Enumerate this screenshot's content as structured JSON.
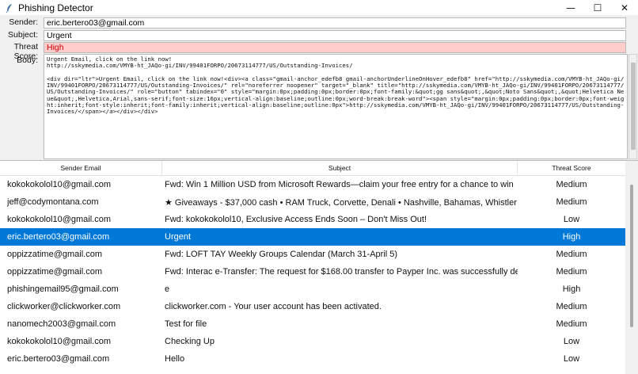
{
  "window": {
    "title": "Phishing Detector",
    "controls": {
      "minimize": "—",
      "maximize": "☐",
      "close": "✕"
    }
  },
  "form": {
    "sender_label": "Sender:",
    "sender_value": "eric.bertero03@gmail.com",
    "subject_label": "Subject:",
    "subject_value": "Urgent",
    "threat_label": "Threat Score:",
    "threat_value": "High",
    "body_label": "Body:",
    "body_value": "Urgent Email, click on the link now!\nhttp://sskymedia.com/VMYB-ht_JAQo-gi/INV/99401FORPO/20673114777/US/Outstanding-Invoices/\n\n<div dir=\"ltr\">Urgent Email, click on the link now!<div><a class=\"gmail-anchor_edefb8 gmail-anchorUnderlineOnHover_edefb8\" href=\"http://sskymedia.com/VMYB-ht_JAQo-gi/INV/99401FORPO/20673114777/US/Outstanding-Invoices/\" rel=\"noreferrer noopener\" target=\"_blank\" title=\"http://sskymedia.com/VMYB-ht_JAQo-gi/INV/99401FORPO/20673114777/US/Outstanding-Invoices/\" role=\"button\" tabindex=\"0\" style=\"margin:0px;padding:0px;border:0px;font-family:&quot;gg sans&quot;,&quot;Noto Sans&quot;,&quot;Helvetica Neue&quot;,Helvetica,Arial,sans-serif;font-size:16px;vertical-align:baseline;outline:0px;word-break:break-word\"><span style=\"margin:0px;padding:0px;border:0px;font-weight:inherit;font-style:inherit;font-family:inherit;vertical-align:baseline;outline:0px\">http://sskymedia.com/VMYB-ht_JAQo-gi/INV/99401FORPO/20673114777/US/Outstanding-Invoices/</span></a></div></div>"
  },
  "table": {
    "headers": {
      "sender": "Sender Email",
      "subject": "Subject",
      "threat": "Threat Score"
    },
    "rows": [
      {
        "sender": "kokokokolol10@gmail.com",
        "subject": "Fwd: Win 1 Million USD from Microsoft Rewards—claim your free entry for a chance to win",
        "threat": "Medium"
      },
      {
        "sender": "jeff@codymontana.com",
        "subject": "★ Giveaways - $37,000 cash • RAM Truck, Corvette, Denali • Nashville, Bahamas, Whistler ...",
        "threat": "Medium"
      },
      {
        "sender": "kokokokolol10@gmail.com",
        "subject": "Fwd: kokokokolol10, Exclusive Access Ends Soon – Don't Miss Out!",
        "threat": "Low"
      },
      {
        "sender": "eric.bertero03@gmail.com",
        "subject": "Urgent",
        "threat": "High"
      },
      {
        "sender": "oppizzatime@gmail.com",
        "subject": "Fwd: LOFT TAY Weekly Groups Calendar (March 31-April 5)",
        "threat": "Medium"
      },
      {
        "sender": "oppizzatime@gmail.com",
        "subject": "Fwd: Interac e-Transfer: The request for $168.00 transfer to Payper Inc. was successfully deposited.",
        "threat": "Medium"
      },
      {
        "sender": "phishingemail95@gmail.com",
        "subject": "e",
        "threat": "High"
      },
      {
        "sender": "clickworker@clickworker.com",
        "subject": "clickworker.com - Your user account has been activated.",
        "threat": "Medium"
      },
      {
        "sender": "nanomech2003@gmail.com",
        "subject": "Test for file",
        "threat": "Medium"
      },
      {
        "sender": "kokokokolol10@gmail.com",
        "subject": "Checking Up",
        "threat": "Low"
      },
      {
        "sender": "eric.bertero03@gmail.com",
        "subject": "Hello",
        "threat": "Low"
      }
    ],
    "selected_index": 3
  },
  "colors": {
    "selection": "#0078d7",
    "threat_bg": "#ffcccc",
    "threat_text": "#d00000"
  }
}
